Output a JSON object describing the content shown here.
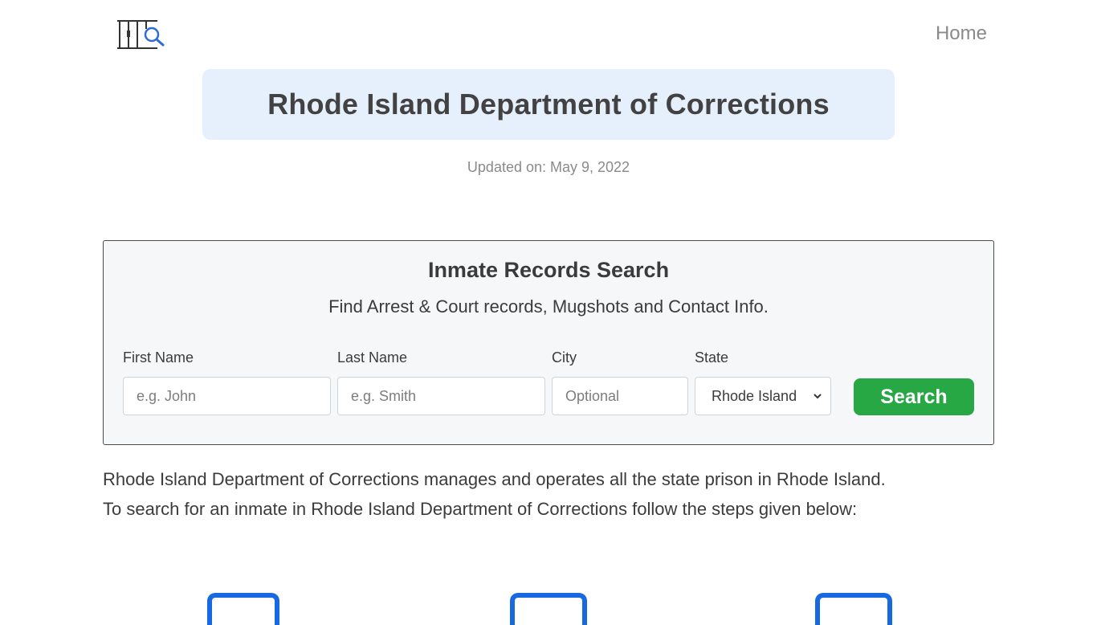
{
  "header": {
    "logo_icon": "jail-bars-magnifier-icon",
    "nav_home_label": "Home"
  },
  "title": "Rhode Island Department of Corrections",
  "updated_text": "Updated on: May 9, 2022",
  "search": {
    "title": "Inmate Records Search",
    "subtitle": "Find Arrest & Court records, Mugshots and Contact Info.",
    "fields": [
      {
        "label": "First Name",
        "placeholder": "e.g. John",
        "value": ""
      },
      {
        "label": "Last Name",
        "placeholder": "e.g. Smith",
        "value": ""
      },
      {
        "label": "City",
        "placeholder": "Optional",
        "value": ""
      },
      {
        "label": "State",
        "selected": "Rhode Island"
      }
    ],
    "button_label": "Search",
    "button_color": "#28a745"
  },
  "intro": {
    "line1": "Rhode Island Department of Corrections manages and operates all the state prison in Rhode Island.",
    "line2": "To search for an inmate in Rhode Island Department of Corrections follow the steps given below:"
  },
  "colors": {
    "banner_bg": "#e6effc",
    "accent_blue": "#1669e0"
  }
}
